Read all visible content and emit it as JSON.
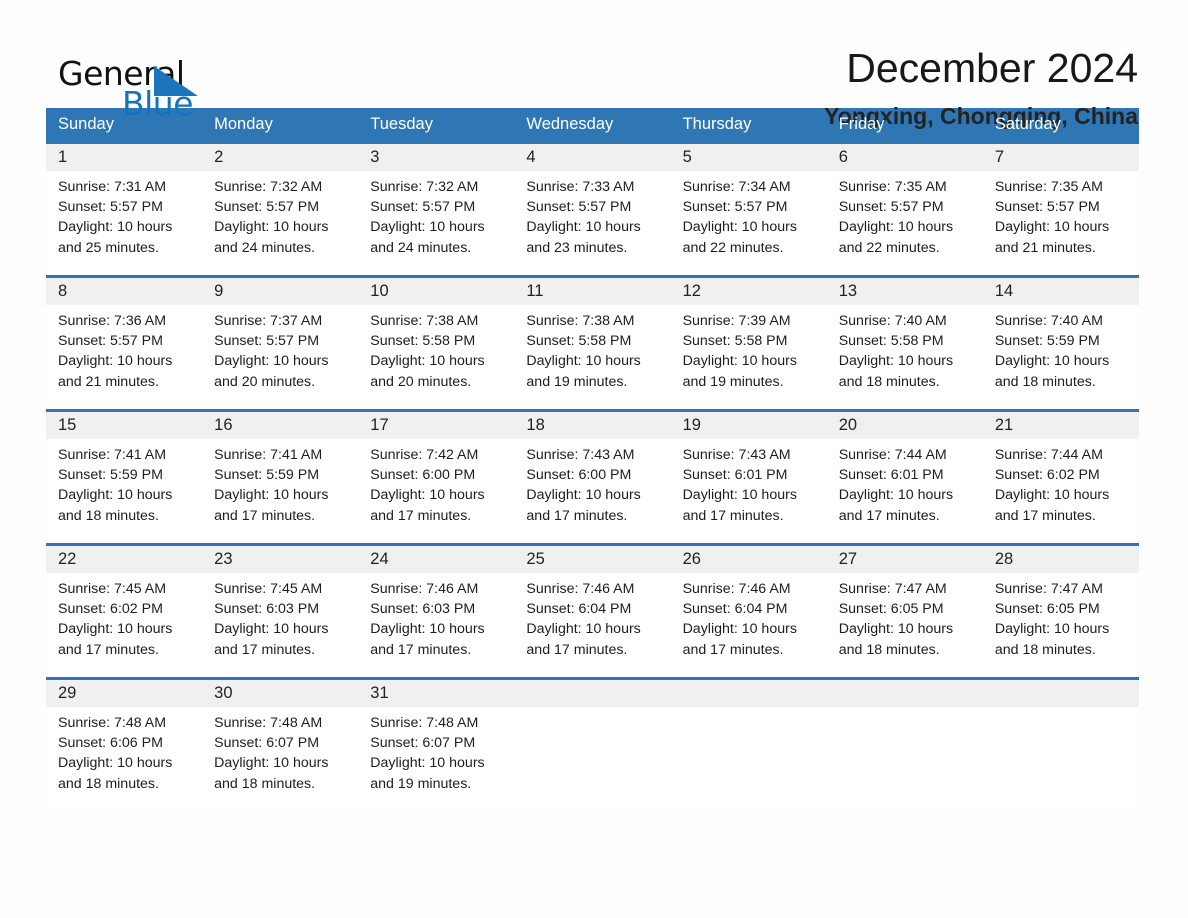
{
  "brand": {
    "word_one": "General",
    "word_two": "Blue",
    "triangle_icon": "triangle-icon"
  },
  "header": {
    "month_title": "December 2024",
    "location": "Yongxing, Chongqing, China"
  },
  "colors": {
    "header_blue": "#2f76b5",
    "brand_blue": "#1473bd",
    "day_strip_gray": "#f0f0f0",
    "page_background": "#fefefe",
    "text": "#1d1d1d"
  },
  "calendar": {
    "weekdays": [
      "Sunday",
      "Monday",
      "Tuesday",
      "Wednesday",
      "Thursday",
      "Friday",
      "Saturday"
    ],
    "weeks": [
      [
        {
          "day": "1",
          "lines": [
            "Sunrise: 7:31 AM",
            "Sunset: 5:57 PM",
            "Daylight: 10 hours",
            "and 25 minutes."
          ]
        },
        {
          "day": "2",
          "lines": [
            "Sunrise: 7:32 AM",
            "Sunset: 5:57 PM",
            "Daylight: 10 hours",
            "and 24 minutes."
          ]
        },
        {
          "day": "3",
          "lines": [
            "Sunrise: 7:32 AM",
            "Sunset: 5:57 PM",
            "Daylight: 10 hours",
            "and 24 minutes."
          ]
        },
        {
          "day": "4",
          "lines": [
            "Sunrise: 7:33 AM",
            "Sunset: 5:57 PM",
            "Daylight: 10 hours",
            "and 23 minutes."
          ]
        },
        {
          "day": "5",
          "lines": [
            "Sunrise: 7:34 AM",
            "Sunset: 5:57 PM",
            "Daylight: 10 hours",
            "and 22 minutes."
          ]
        },
        {
          "day": "6",
          "lines": [
            "Sunrise: 7:35 AM",
            "Sunset: 5:57 PM",
            "Daylight: 10 hours",
            "and 22 minutes."
          ]
        },
        {
          "day": "7",
          "lines": [
            "Sunrise: 7:35 AM",
            "Sunset: 5:57 PM",
            "Daylight: 10 hours",
            "and 21 minutes."
          ]
        }
      ],
      [
        {
          "day": "8",
          "lines": [
            "Sunrise: 7:36 AM",
            "Sunset: 5:57 PM",
            "Daylight: 10 hours",
            "and 21 minutes."
          ]
        },
        {
          "day": "9",
          "lines": [
            "Sunrise: 7:37 AM",
            "Sunset: 5:57 PM",
            "Daylight: 10 hours",
            "and 20 minutes."
          ]
        },
        {
          "day": "10",
          "lines": [
            "Sunrise: 7:38 AM",
            "Sunset: 5:58 PM",
            "Daylight: 10 hours",
            "and 20 minutes."
          ]
        },
        {
          "day": "11",
          "lines": [
            "Sunrise: 7:38 AM",
            "Sunset: 5:58 PM",
            "Daylight: 10 hours",
            "and 19 minutes."
          ]
        },
        {
          "day": "12",
          "lines": [
            "Sunrise: 7:39 AM",
            "Sunset: 5:58 PM",
            "Daylight: 10 hours",
            "and 19 minutes."
          ]
        },
        {
          "day": "13",
          "lines": [
            "Sunrise: 7:40 AM",
            "Sunset: 5:58 PM",
            "Daylight: 10 hours",
            "and 18 minutes."
          ]
        },
        {
          "day": "14",
          "lines": [
            "Sunrise: 7:40 AM",
            "Sunset: 5:59 PM",
            "Daylight: 10 hours",
            "and 18 minutes."
          ]
        }
      ],
      [
        {
          "day": "15",
          "lines": [
            "Sunrise: 7:41 AM",
            "Sunset: 5:59 PM",
            "Daylight: 10 hours",
            "and 18 minutes."
          ]
        },
        {
          "day": "16",
          "lines": [
            "Sunrise: 7:41 AM",
            "Sunset: 5:59 PM",
            "Daylight: 10 hours",
            "and 17 minutes."
          ]
        },
        {
          "day": "17",
          "lines": [
            "Sunrise: 7:42 AM",
            "Sunset: 6:00 PM",
            "Daylight: 10 hours",
            "and 17 minutes."
          ]
        },
        {
          "day": "18",
          "lines": [
            "Sunrise: 7:43 AM",
            "Sunset: 6:00 PM",
            "Daylight: 10 hours",
            "and 17 minutes."
          ]
        },
        {
          "day": "19",
          "lines": [
            "Sunrise: 7:43 AM",
            "Sunset: 6:01 PM",
            "Daylight: 10 hours",
            "and 17 minutes."
          ]
        },
        {
          "day": "20",
          "lines": [
            "Sunrise: 7:44 AM",
            "Sunset: 6:01 PM",
            "Daylight: 10 hours",
            "and 17 minutes."
          ]
        },
        {
          "day": "21",
          "lines": [
            "Sunrise: 7:44 AM",
            "Sunset: 6:02 PM",
            "Daylight: 10 hours",
            "and 17 minutes."
          ]
        }
      ],
      [
        {
          "day": "22",
          "lines": [
            "Sunrise: 7:45 AM",
            "Sunset: 6:02 PM",
            "Daylight: 10 hours",
            "and 17 minutes."
          ]
        },
        {
          "day": "23",
          "lines": [
            "Sunrise: 7:45 AM",
            "Sunset: 6:03 PM",
            "Daylight: 10 hours",
            "and 17 minutes."
          ]
        },
        {
          "day": "24",
          "lines": [
            "Sunrise: 7:46 AM",
            "Sunset: 6:03 PM",
            "Daylight: 10 hours",
            "and 17 minutes."
          ]
        },
        {
          "day": "25",
          "lines": [
            "Sunrise: 7:46 AM",
            "Sunset: 6:04 PM",
            "Daylight: 10 hours",
            "and 17 minutes."
          ]
        },
        {
          "day": "26",
          "lines": [
            "Sunrise: 7:46 AM",
            "Sunset: 6:04 PM",
            "Daylight: 10 hours",
            "and 17 minutes."
          ]
        },
        {
          "day": "27",
          "lines": [
            "Sunrise: 7:47 AM",
            "Sunset: 6:05 PM",
            "Daylight: 10 hours",
            "and 18 minutes."
          ]
        },
        {
          "day": "28",
          "lines": [
            "Sunrise: 7:47 AM",
            "Sunset: 6:05 PM",
            "Daylight: 10 hours",
            "and 18 minutes."
          ]
        }
      ],
      [
        {
          "day": "29",
          "lines": [
            "Sunrise: 7:48 AM",
            "Sunset: 6:06 PM",
            "Daylight: 10 hours",
            "and 18 minutes."
          ]
        },
        {
          "day": "30",
          "lines": [
            "Sunrise: 7:48 AM",
            "Sunset: 6:07 PM",
            "Daylight: 10 hours",
            "and 18 minutes."
          ]
        },
        {
          "day": "31",
          "lines": [
            "Sunrise: 7:48 AM",
            "Sunset: 6:07 PM",
            "Daylight: 10 hours",
            "and 19 minutes."
          ]
        },
        {
          "day": "",
          "lines": []
        },
        {
          "day": "",
          "lines": []
        },
        {
          "day": "",
          "lines": []
        },
        {
          "day": "",
          "lines": []
        }
      ]
    ]
  }
}
